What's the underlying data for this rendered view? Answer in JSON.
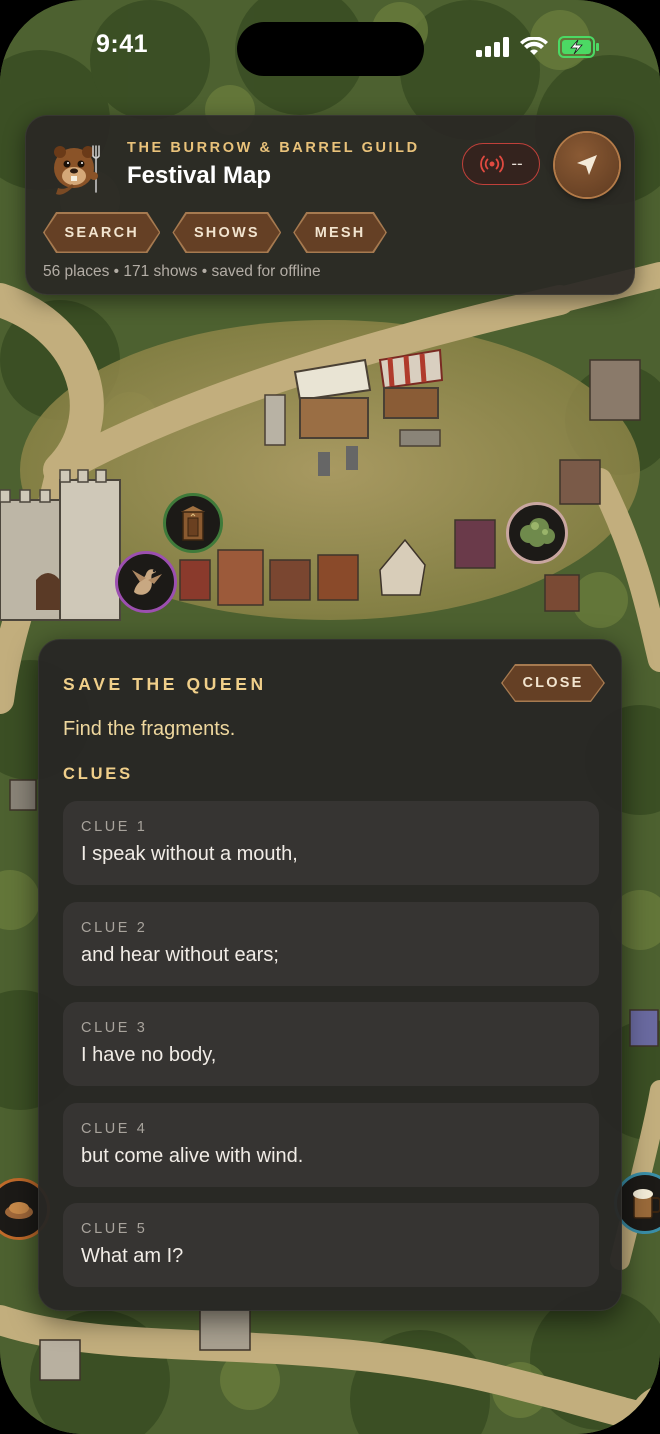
{
  "status_bar": {
    "time": "9:41"
  },
  "header": {
    "guild_name": "THE BURROW & BARREL GUILD",
    "title": "Festival Map",
    "mesh_status_text": "--",
    "chips": [
      {
        "label": "SEARCH"
      },
      {
        "label": "SHOWS"
      },
      {
        "label": "MESH"
      }
    ],
    "stats": "56 places • 171 shows • saved for offline"
  },
  "quest": {
    "title": "SAVE THE QUEEN",
    "close_label": "CLOSE",
    "subtitle": "Find the fragments.",
    "clues_heading": "CLUES",
    "clues": [
      {
        "label": "CLUE 1",
        "text": "I speak without a mouth,"
      },
      {
        "label": "CLUE 2",
        "text": "and hear without ears;"
      },
      {
        "label": "CLUE 3",
        "text": "I have no body,"
      },
      {
        "label": "CLUE 4",
        "text": "but come alive with wind."
      },
      {
        "label": "CLUE 5",
        "text": "What am I?"
      }
    ]
  },
  "markers": [
    {
      "icon": "outhouse-icon",
      "ring": "#3f7a3a"
    },
    {
      "icon": "dragon-icon",
      "ring": "#9c4fb0"
    },
    {
      "icon": "bush-icon",
      "ring": "#c9a6a0"
    },
    {
      "icon": "roast-food-icon",
      "ring": "#c06a2a"
    },
    {
      "icon": "beer-mug-icon",
      "ring": "#3a8fa8"
    }
  ],
  "colors": {
    "accent_gold": "#f0cf8a",
    "chip_brown": "#654025",
    "alert_red": "#c0403a"
  }
}
